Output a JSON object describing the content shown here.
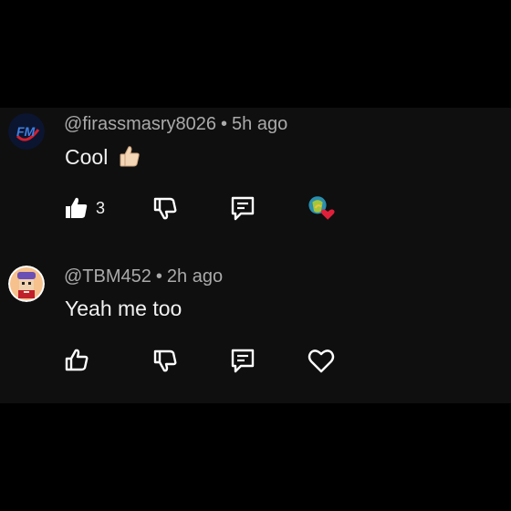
{
  "comments": [
    {
      "handle": "@firassmasry8026",
      "separator": "•",
      "age": "5h ago",
      "text": "Cool",
      "emoji": "thumbs-up-emoji",
      "like_count": "3",
      "hearted_by_creator": true,
      "avatar_text": "FM"
    },
    {
      "handle": "@TBM452",
      "separator": "•",
      "age": "2h ago",
      "text": "Yeah me too",
      "like_count": "",
      "hearted_by_creator": false
    }
  ],
  "icons": {
    "like": "thumbs-up-icon",
    "dislike": "thumbs-down-icon",
    "reply": "reply-comment-icon",
    "heart": "heart-icon"
  },
  "colors": {
    "background": "#000000",
    "panel": "#0f0f0f",
    "meta_text": "#aaaaaa",
    "primary_text": "#f1f1f1",
    "heart_red": "#e0203a"
  }
}
